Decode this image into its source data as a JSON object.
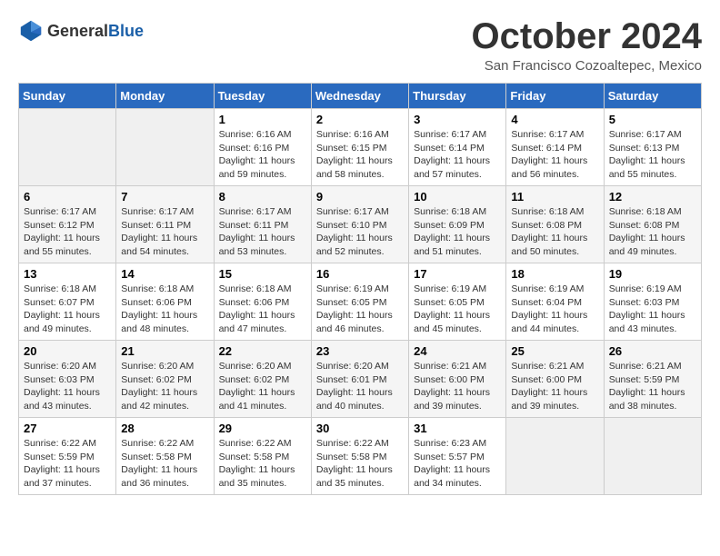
{
  "header": {
    "logo_general": "General",
    "logo_blue": "Blue",
    "month": "October 2024",
    "location": "San Francisco Cozoaltepec, Mexico"
  },
  "weekdays": [
    "Sunday",
    "Monday",
    "Tuesday",
    "Wednesday",
    "Thursday",
    "Friday",
    "Saturday"
  ],
  "weeks": [
    [
      {
        "day": "",
        "data": ""
      },
      {
        "day": "",
        "data": ""
      },
      {
        "day": "1",
        "data": "Sunrise: 6:16 AM\nSunset: 6:16 PM\nDaylight: 11 hours and 59 minutes."
      },
      {
        "day": "2",
        "data": "Sunrise: 6:16 AM\nSunset: 6:15 PM\nDaylight: 11 hours and 58 minutes."
      },
      {
        "day": "3",
        "data": "Sunrise: 6:17 AM\nSunset: 6:14 PM\nDaylight: 11 hours and 57 minutes."
      },
      {
        "day": "4",
        "data": "Sunrise: 6:17 AM\nSunset: 6:14 PM\nDaylight: 11 hours and 56 minutes."
      },
      {
        "day": "5",
        "data": "Sunrise: 6:17 AM\nSunset: 6:13 PM\nDaylight: 11 hours and 55 minutes."
      }
    ],
    [
      {
        "day": "6",
        "data": "Sunrise: 6:17 AM\nSunset: 6:12 PM\nDaylight: 11 hours and 55 minutes."
      },
      {
        "day": "7",
        "data": "Sunrise: 6:17 AM\nSunset: 6:11 PM\nDaylight: 11 hours and 54 minutes."
      },
      {
        "day": "8",
        "data": "Sunrise: 6:17 AM\nSunset: 6:11 PM\nDaylight: 11 hours and 53 minutes."
      },
      {
        "day": "9",
        "data": "Sunrise: 6:17 AM\nSunset: 6:10 PM\nDaylight: 11 hours and 52 minutes."
      },
      {
        "day": "10",
        "data": "Sunrise: 6:18 AM\nSunset: 6:09 PM\nDaylight: 11 hours and 51 minutes."
      },
      {
        "day": "11",
        "data": "Sunrise: 6:18 AM\nSunset: 6:08 PM\nDaylight: 11 hours and 50 minutes."
      },
      {
        "day": "12",
        "data": "Sunrise: 6:18 AM\nSunset: 6:08 PM\nDaylight: 11 hours and 49 minutes."
      }
    ],
    [
      {
        "day": "13",
        "data": "Sunrise: 6:18 AM\nSunset: 6:07 PM\nDaylight: 11 hours and 49 minutes."
      },
      {
        "day": "14",
        "data": "Sunrise: 6:18 AM\nSunset: 6:06 PM\nDaylight: 11 hours and 48 minutes."
      },
      {
        "day": "15",
        "data": "Sunrise: 6:18 AM\nSunset: 6:06 PM\nDaylight: 11 hours and 47 minutes."
      },
      {
        "day": "16",
        "data": "Sunrise: 6:19 AM\nSunset: 6:05 PM\nDaylight: 11 hours and 46 minutes."
      },
      {
        "day": "17",
        "data": "Sunrise: 6:19 AM\nSunset: 6:05 PM\nDaylight: 11 hours and 45 minutes."
      },
      {
        "day": "18",
        "data": "Sunrise: 6:19 AM\nSunset: 6:04 PM\nDaylight: 11 hours and 44 minutes."
      },
      {
        "day": "19",
        "data": "Sunrise: 6:19 AM\nSunset: 6:03 PM\nDaylight: 11 hours and 43 minutes."
      }
    ],
    [
      {
        "day": "20",
        "data": "Sunrise: 6:20 AM\nSunset: 6:03 PM\nDaylight: 11 hours and 43 minutes."
      },
      {
        "day": "21",
        "data": "Sunrise: 6:20 AM\nSunset: 6:02 PM\nDaylight: 11 hours and 42 minutes."
      },
      {
        "day": "22",
        "data": "Sunrise: 6:20 AM\nSunset: 6:02 PM\nDaylight: 11 hours and 41 minutes."
      },
      {
        "day": "23",
        "data": "Sunrise: 6:20 AM\nSunset: 6:01 PM\nDaylight: 11 hours and 40 minutes."
      },
      {
        "day": "24",
        "data": "Sunrise: 6:21 AM\nSunset: 6:00 PM\nDaylight: 11 hours and 39 minutes."
      },
      {
        "day": "25",
        "data": "Sunrise: 6:21 AM\nSunset: 6:00 PM\nDaylight: 11 hours and 39 minutes."
      },
      {
        "day": "26",
        "data": "Sunrise: 6:21 AM\nSunset: 5:59 PM\nDaylight: 11 hours and 38 minutes."
      }
    ],
    [
      {
        "day": "27",
        "data": "Sunrise: 6:22 AM\nSunset: 5:59 PM\nDaylight: 11 hours and 37 minutes."
      },
      {
        "day": "28",
        "data": "Sunrise: 6:22 AM\nSunset: 5:58 PM\nDaylight: 11 hours and 36 minutes."
      },
      {
        "day": "29",
        "data": "Sunrise: 6:22 AM\nSunset: 5:58 PM\nDaylight: 11 hours and 35 minutes."
      },
      {
        "day": "30",
        "data": "Sunrise: 6:22 AM\nSunset: 5:58 PM\nDaylight: 11 hours and 35 minutes."
      },
      {
        "day": "31",
        "data": "Sunrise: 6:23 AM\nSunset: 5:57 PM\nDaylight: 11 hours and 34 minutes."
      },
      {
        "day": "",
        "data": ""
      },
      {
        "day": "",
        "data": ""
      }
    ]
  ]
}
